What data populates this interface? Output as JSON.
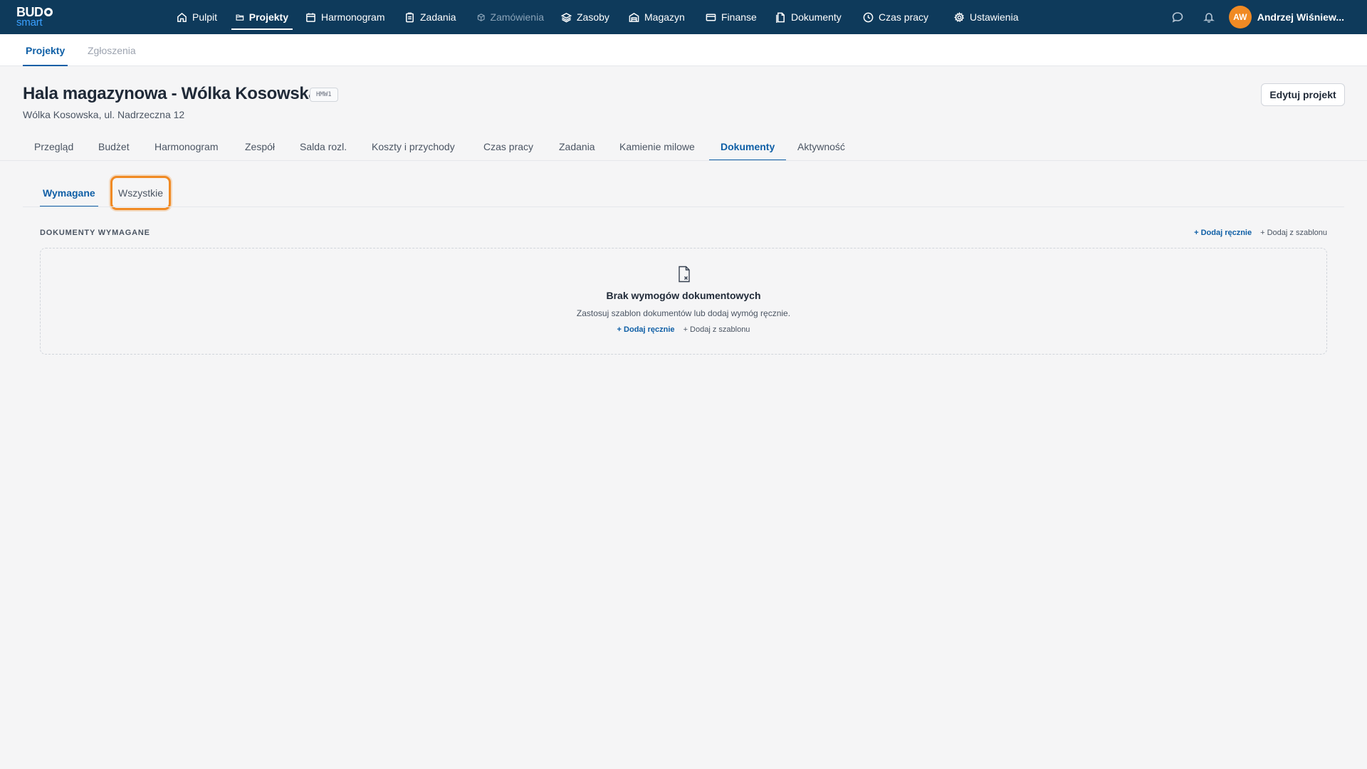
{
  "app": {
    "logo_line1": "BUD",
    "logo_line2": "smart"
  },
  "nav": {
    "items": [
      {
        "label": "Pulpit",
        "icon": "home-icon"
      },
      {
        "label": "Projekty",
        "icon": "folder-icon",
        "active": true
      },
      {
        "label": "Harmonogram",
        "icon": "calendar-icon"
      },
      {
        "label": "Zadania",
        "icon": "clipboard-icon"
      },
      {
        "label": "Zamówienia",
        "icon": "package-icon",
        "disabled": true
      },
      {
        "label": "Zasoby",
        "icon": "layers-icon"
      },
      {
        "label": "Magazyn",
        "icon": "warehouse-icon"
      },
      {
        "label": "Finanse",
        "icon": "credit-card-icon"
      },
      {
        "label": "Dokumenty",
        "icon": "documents-icon"
      },
      {
        "label": "Czas pracy",
        "icon": "clock-icon"
      },
      {
        "label": "Ustawienia",
        "icon": "gear-icon"
      }
    ]
  },
  "user": {
    "initials": "AW",
    "name": "Andrzej Wiśniew..."
  },
  "subnav": {
    "items": [
      {
        "label": "Projekty",
        "active": true
      },
      {
        "label": "Zgłoszenia"
      }
    ]
  },
  "project": {
    "title": "Hala magazynowa - Wólka Kosowska",
    "code": "HMW1",
    "address": "Wólka Kosowska, ul. Nadrzeczna 12",
    "edit_label": "Edytuj projekt"
  },
  "project_tabs": [
    "Przegląd",
    "Budżet",
    "Harmonogram",
    "Zespół",
    "Salda rozl.",
    "Koszty i przychody",
    "Czas pracy",
    "Zadania",
    "Kamienie milowe",
    "Dokumenty",
    "Aktywność"
  ],
  "project_tabs_active": "Dokumenty",
  "doc_tabs": {
    "required": "Wymagane",
    "all": "Wszystkie"
  },
  "documents": {
    "section_label": "DOKUMENTY WYMAGANE",
    "add_manual": "+ Dodaj ręcznie",
    "add_template": "+ Dodaj z szablonu",
    "empty_title": "Brak wymogów dokumentowych",
    "empty_desc": "Zastosuj szablon dokumentów lub dodaj wymóg ręcznie."
  },
  "colors": {
    "navbar": "#0e3a5b",
    "accent": "#0f5fa6",
    "avatar": "#f08a24",
    "focus_ring": "#f08a24"
  }
}
